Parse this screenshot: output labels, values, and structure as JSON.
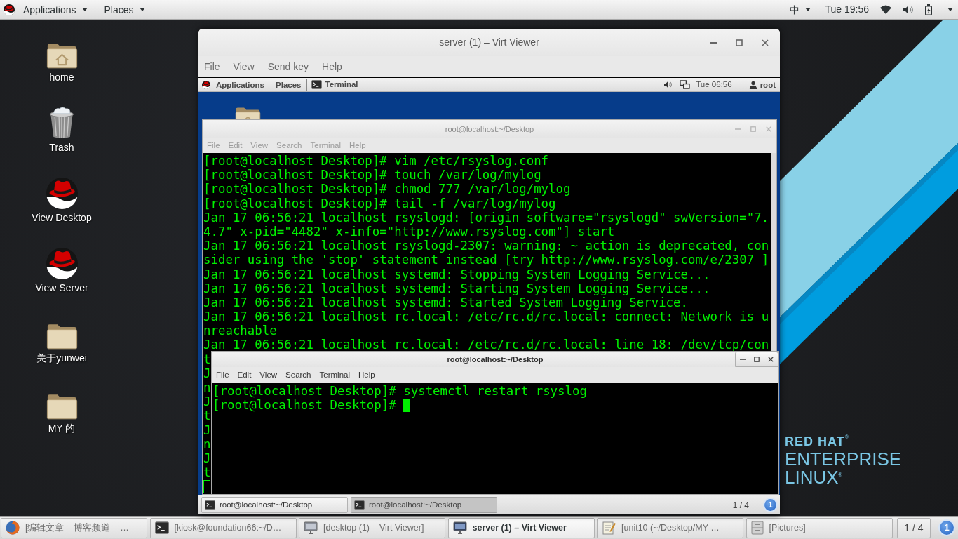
{
  "top_bar": {
    "menus": [
      {
        "label": "Applications"
      },
      {
        "label": "Places"
      }
    ],
    "input_method": "中",
    "clock": "Tue 19:56"
  },
  "desktop_icons": [
    {
      "label": "home",
      "kind": "home"
    },
    {
      "label": "Trash",
      "kind": "trash"
    },
    {
      "label": "View Desktop",
      "kind": "launcher"
    },
    {
      "label": "View Server",
      "kind": "launcher"
    },
    {
      "label": "关于yunwei",
      "kind": "folder"
    },
    {
      "label": "MY 的",
      "kind": "folder"
    }
  ],
  "wallpaper_logo": [
    {
      "text": "RED HAT$^{®}$",
      "kind": "brand"
    },
    {
      "text": "ENTERPRISE",
      "kind": "product"
    },
    {
      "text": "LINUX$^{®}$",
      "kind": "product"
    }
  ],
  "virt_viewer": {
    "title": "server (1) – Virt Viewer",
    "menu": [
      "File",
      "View",
      "Send key",
      "Help"
    ],
    "guest": {
      "top_bar": {
        "menus": [
          "Applications",
          "Places"
        ],
        "app": "Terminal",
        "clock": "Tue 06:56",
        "user": "root"
      },
      "terminals": [
        {
          "title": "root@localhost:~/Desktop",
          "active": false,
          "menu": [
            "File",
            "Edit",
            "View",
            "Search",
            "Terminal",
            "Help"
          ],
          "lines": [
            "[root@localhost Desktop]# vim /etc/rsyslog.conf",
            "[root@localhost Desktop]# touch /var/log/mylog",
            "[root@localhost Desktop]# chmod 777 /var/log/mylog",
            "[root@localhost Desktop]# tail -f /var/log/mylog",
            "Jan 17 06:56:21 localhost rsyslogd: [origin software=\"rsyslogd\" swVersion=\"7.",
            "4.7\" x-pid=\"4482\" x-info=\"http://www.rsyslog.com\"] start",
            "Jan 17 06:56:21 localhost rsyslogd-2307: warning: ~ action is deprecated, con",
            "sider using the 'stop' statement instead [try http://www.rsyslog.com/e/2307 ]",
            "Jan 17 06:56:21 localhost systemd: Stopping System Logging Service...",
            "Jan 17 06:56:21 localhost systemd: Starting System Logging Service...",
            "Jan 17 06:56:21 localhost systemd: Started System Logging Service.",
            "Jan 17 06:56:21 localhost rc.local: /etc/rc.d/rc.local: connect: Network is u",
            "nreachable",
            "Jan 17 06:56:21 localhost rc.local: /etc/rc.d/rc.local: line 18: /dev/tcp/con",
            "t",
            "J",
            "n",
            "J",
            "t",
            "J",
            "n",
            "J",
            "t"
          ]
        },
        {
          "title": "root@localhost:~/Desktop",
          "active": true,
          "menu": [
            "File",
            "Edit",
            "View",
            "Search",
            "Terminal",
            "Help"
          ],
          "lines": [
            "[root@localhost Desktop]# systemctl restart rsyslog"
          ],
          "prompt": "[root@localhost Desktop]# "
        }
      ],
      "taskbar": {
        "items": [
          {
            "label": "root@localhost:~/Desktop",
            "selected": false
          },
          {
            "label": "root@localhost:~/Desktop",
            "selected": true
          }
        ],
        "workspace": "1 / 4",
        "badge": "1"
      }
    }
  },
  "taskbar": {
    "items": [
      {
        "label": "[编辑文章 – 博客频道 – …",
        "kind": "browser",
        "selected": false
      },
      {
        "label": "[kiosk@foundation66:~/D…",
        "kind": "terminal",
        "selected": false
      },
      {
        "label": "[desktop (1) – Virt Viewer]",
        "kind": "viewer",
        "selected": false
      },
      {
        "label": "server (1) – Virt Viewer",
        "kind": "viewer",
        "selected": true
      },
      {
        "label": "[unit10 (~/Desktop/MY …",
        "kind": "editor",
        "selected": false
      },
      {
        "label": "[Pictures]",
        "kind": "files",
        "selected": false
      }
    ],
    "workspace": "1 / 4",
    "badge": "1"
  }
}
